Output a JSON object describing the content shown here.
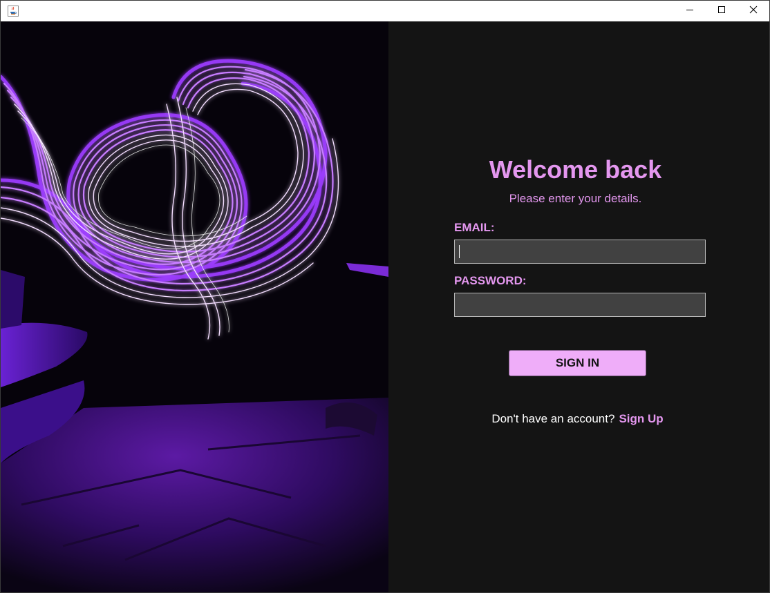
{
  "window": {
    "title": "",
    "icons": {
      "app": "java-cup-icon",
      "minimize": "minimize-icon",
      "maximize": "maximize-icon",
      "close": "close-icon"
    }
  },
  "login": {
    "title": "Welcome back",
    "subtitle": "Please enter your details.",
    "email_label": "EMAIL:",
    "email_value": "",
    "password_label": "PASSWORD:",
    "password_value": "",
    "signin_label": "SIGN IN",
    "signup_prompt": "Don't have an account?",
    "signup_link": "Sign Up"
  },
  "colors": {
    "accent": "#e497ef",
    "button": "#efadf9",
    "panel_background": "#141414",
    "input_background": "#414141"
  }
}
